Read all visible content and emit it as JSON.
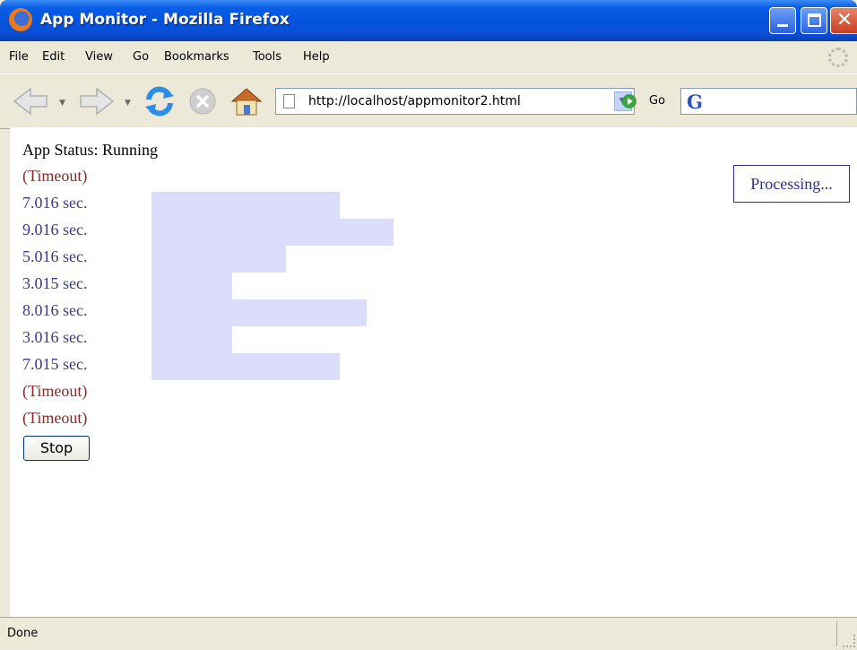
{
  "window": {
    "title": "App Monitor - Mozilla Firefox",
    "close_glyph": "✕"
  },
  "menu": {
    "file": "File",
    "edit": "Edit",
    "view": "View",
    "go": "Go",
    "bookmarks": "Bookmarks",
    "tools": "Tools",
    "help": "Help"
  },
  "toolbar": {
    "url": "http://localhost/appmonitor2.html",
    "go_label": "Go",
    "search_logo": "G"
  },
  "page": {
    "status_text": "App Status: Running",
    "processing_label": "Processing...",
    "stop_label": "Stop",
    "rows": [
      {
        "text": "(Timeout)",
        "kind": "timeout"
      },
      {
        "text": "7.016 sec.",
        "kind": "timing",
        "seconds": 7.016
      },
      {
        "text": "9.016 sec.",
        "kind": "timing",
        "seconds": 9.016
      },
      {
        "text": "5.016 sec.",
        "kind": "timing",
        "seconds": 5.016
      },
      {
        "text": "3.015 sec.",
        "kind": "timing",
        "seconds": 3.015
      },
      {
        "text": "8.016 sec.",
        "kind": "timing",
        "seconds": 8.016
      },
      {
        "text": "3.016 sec.",
        "kind": "timing",
        "seconds": 3.016
      },
      {
        "text": "7.015 sec.",
        "kind": "timing",
        "seconds": 7.015
      },
      {
        "text": "(Timeout)",
        "kind": "timeout"
      },
      {
        "text": "(Timeout)",
        "kind": "timeout"
      }
    ]
  },
  "statusbar": {
    "text": "Done"
  },
  "colors": {
    "timeout": "#8b2a2a",
    "timing": "#3b3b8f",
    "bar": "#dcdcfc"
  }
}
